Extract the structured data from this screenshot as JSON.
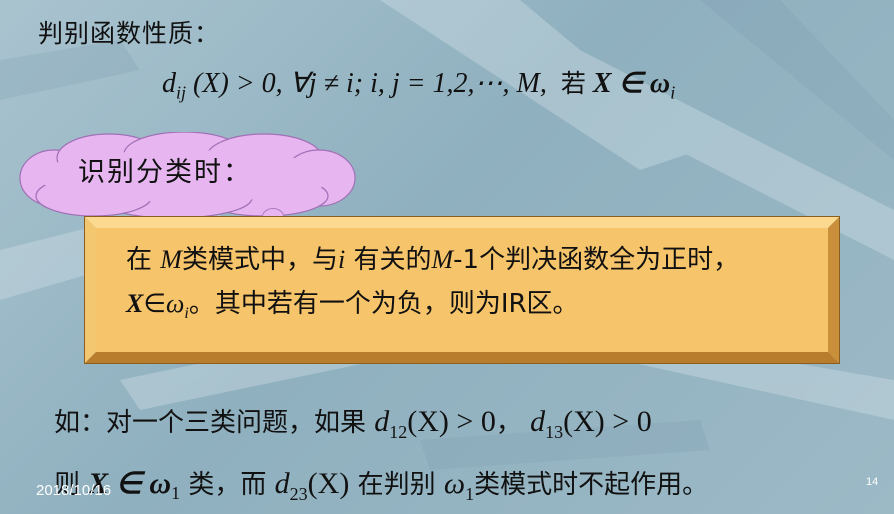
{
  "heading": "判别函数性质：",
  "formula": {
    "d": "d",
    "d_sub": "ij",
    "cond": "(X) > 0,  ∀j ≠ i;  i, j = 1,2,⋯, M,",
    "ruo": "若",
    "member": "X ∈ ω",
    "member_sub": "i"
  },
  "cloud_label": "识别分类时：",
  "box": {
    "p1": "在",
    "M1": "M",
    "p2": "类模式中，与",
    "i1": "i",
    "p3": "有关的",
    "M2": "M",
    "p4": "-1个判决函数全为正时，",
    "X1": "X",
    "p5": "∈",
    "w1": "ω",
    "w1_sub": "i",
    "p6": "。其中若有一个为负，则为IR区。"
  },
  "example": {
    "l1_a": "如：对一个三类问题，如果",
    "l1_d1": "d",
    "l1_d1_sub": "12",
    "l1_m1": "(X) > 0",
    "l1_comma": "，",
    "l1_d2": "d",
    "l1_d2_sub": "13",
    "l1_m2": "(X) > 0",
    "l2_a": "则",
    "l2_m1": "X ∈ ω",
    "l2_m1_sub": "1",
    "l2_b": "类，而",
    "l2_d": "d",
    "l2_d_sub": "23",
    "l2_m2": "(X)",
    "l2_c": "在判别",
    "l2_w": "ω",
    "l2_w_sub": "1",
    "l2_e": "类模式时不起作用。"
  },
  "footer": {
    "date": "2018/10/16",
    "page_number": "14"
  },
  "colors": {
    "background": "#9cb9c6",
    "cloud": "#e7b6f1",
    "box_fill": "#f6c46a",
    "box_bevel": "#e0a548"
  }
}
